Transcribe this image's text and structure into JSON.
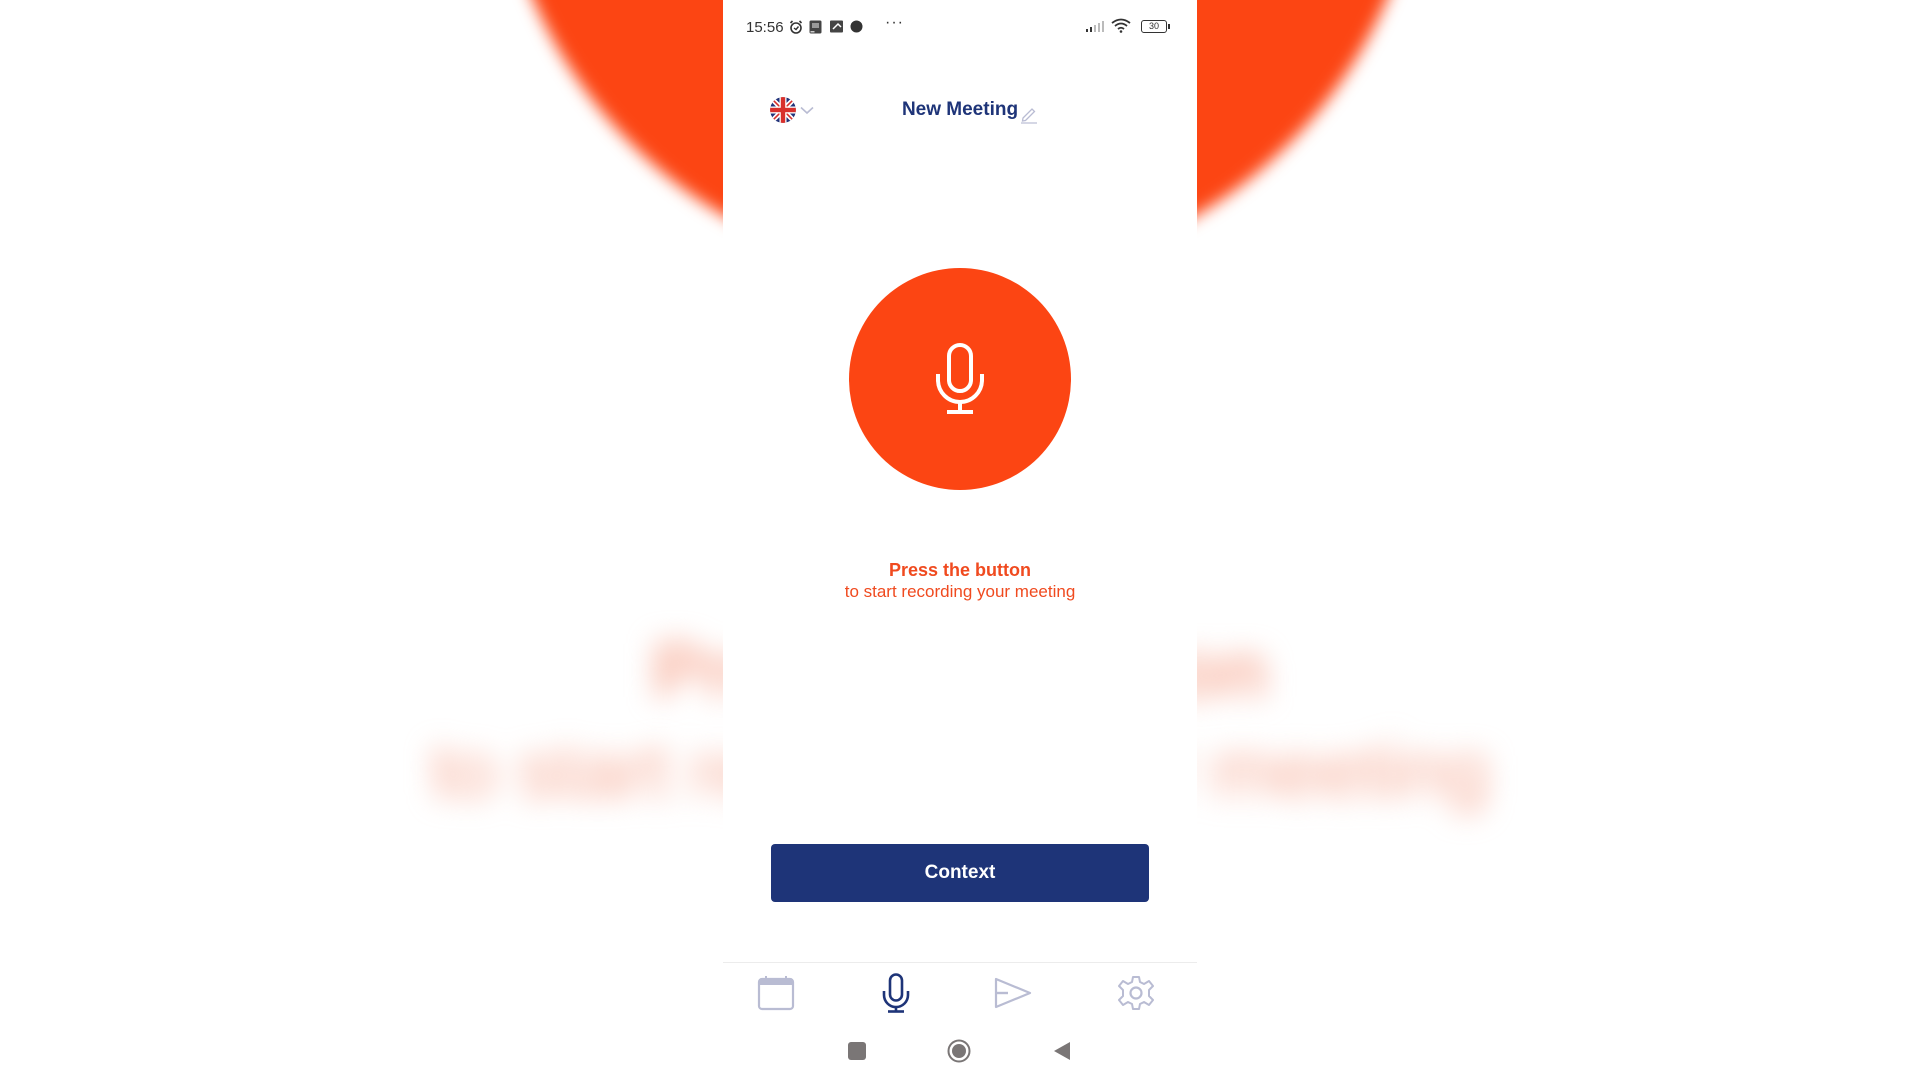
{
  "background": {
    "blurred_title": "Press the button",
    "blurred_subtitle": "to start recording your meeting"
  },
  "status_bar": {
    "time": "15:56",
    "left_icons": [
      "alarm-icon",
      "news-icon",
      "gallery-icon",
      "record-dot-icon"
    ],
    "overflow": "···",
    "battery": "30"
  },
  "header": {
    "language": "English (UK)",
    "title": "New Meeting"
  },
  "recorder": {
    "hint_title": "Press the button",
    "hint_subtitle": "to start recording your meeting"
  },
  "actions": {
    "context_label": "Context"
  },
  "tabs": [
    {
      "name": "calendar",
      "active": false
    },
    {
      "name": "record",
      "active": true
    },
    {
      "name": "send",
      "active": false
    },
    {
      "name": "settings",
      "active": false
    }
  ],
  "colors": {
    "accent_orange": "#fc4513",
    "primary_navy": "#1e3478",
    "hint_text": "#f04a1f",
    "tab_inactive": "#b9bcd3"
  }
}
